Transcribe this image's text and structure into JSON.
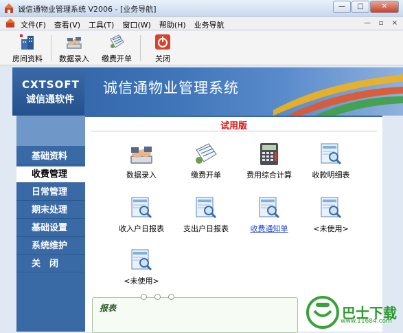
{
  "window": {
    "title": "诚信通物业管理系统 V2006 - [业务导航]",
    "controls": [
      "—",
      "□",
      "✕"
    ]
  },
  "menubar": {
    "items": [
      "文件(F)",
      "查看(V)",
      "工具(T)",
      "窗口(W)",
      "帮助(H)",
      "业务导航"
    ],
    "mdi_controls": [
      "—",
      "▫",
      "×"
    ]
  },
  "toolbar": {
    "items": [
      {
        "label": "房间资料",
        "icon": "building-icon"
      },
      {
        "label": "数据录入",
        "icon": "keyboard-hands-icon"
      },
      {
        "label": "缴费开单",
        "icon": "spreadsheet-icon"
      },
      {
        "label": "关闭",
        "icon": "power-icon"
      }
    ]
  },
  "banner": {
    "logo_en": "CXTSOFT",
    "logo_cn": "诚信通软件",
    "title": "诚信通物业管理系统"
  },
  "nav": {
    "items": [
      "基础资料",
      "收费管理",
      "日常管理",
      "期末处理",
      "基础设置",
      "系统维护",
      "关　闭"
    ],
    "active_index": 1
  },
  "content": {
    "trial_label": "试用版",
    "functions": [
      {
        "label": "数据录入",
        "icon": "keyboard-hands-icon"
      },
      {
        "label": "缴费开单",
        "icon": "spreadsheet-icon"
      },
      {
        "label": "费用综合计算",
        "icon": "calculator-icon"
      },
      {
        "label": "收款明细表",
        "icon": "report-magnifier-icon"
      },
      {
        "label": "收入户日报表",
        "icon": "report-magnifier-icon"
      },
      {
        "label": "支出户日报表",
        "icon": "report-magnifier-icon"
      },
      {
        "label": "收费通知单",
        "icon": "report-magnifier-icon",
        "link": true
      },
      {
        "label": "<未使用>",
        "icon": "report-magnifier-icon"
      },
      {
        "label": "<未使用>",
        "icon": "report-magnifier-icon"
      }
    ],
    "report_title": "报表"
  },
  "watermark": {
    "text": "巴士下载",
    "url": "www.11684.com"
  },
  "colors": {
    "nav_bg": "#3a6aa6",
    "trial_red": "#dd1111",
    "link_blue": "#1a3fc6"
  }
}
